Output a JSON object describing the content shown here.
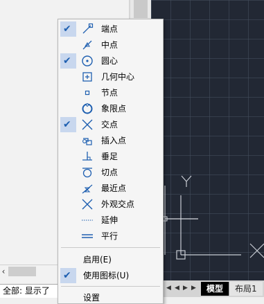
{
  "menu": {
    "items": [
      {
        "label": "端点",
        "checked": true,
        "icon": "endpoint-icon"
      },
      {
        "label": "中点",
        "checked": false,
        "icon": "midpoint-icon"
      },
      {
        "label": "圆心",
        "checked": true,
        "icon": "center-icon"
      },
      {
        "label": "几何中心",
        "checked": false,
        "icon": "geometric-center-icon"
      },
      {
        "label": "节点",
        "checked": false,
        "icon": "node-icon"
      },
      {
        "label": "象限点",
        "checked": false,
        "icon": "quadrant-icon"
      },
      {
        "label": "交点",
        "checked": true,
        "icon": "intersection-icon"
      },
      {
        "label": "插入点",
        "checked": false,
        "icon": "insertion-icon"
      },
      {
        "label": "垂足",
        "checked": false,
        "icon": "perpendicular-icon"
      },
      {
        "label": "切点",
        "checked": false,
        "icon": "tangent-icon"
      },
      {
        "label": "最近点",
        "checked": false,
        "icon": "nearest-icon"
      },
      {
        "label": "外观交点",
        "checked": false,
        "icon": "apparent-intersection-icon"
      },
      {
        "label": "延伸",
        "checked": false,
        "icon": "extension-icon"
      },
      {
        "label": "平行",
        "checked": false,
        "icon": "parallel-icon"
      }
    ],
    "options": [
      {
        "label": "启用(E)",
        "checked": false
      },
      {
        "label": "使用图标(U)",
        "checked": true
      }
    ],
    "last_label": "设置"
  },
  "status": {
    "text": "全部: 显示了"
  },
  "tabs": {
    "model": "模型",
    "layout1": "布局1"
  },
  "colors": {
    "icon_blue": "#1e5fb0",
    "canvas_bg": "#222834",
    "check_bg": "#c8d7ee"
  }
}
